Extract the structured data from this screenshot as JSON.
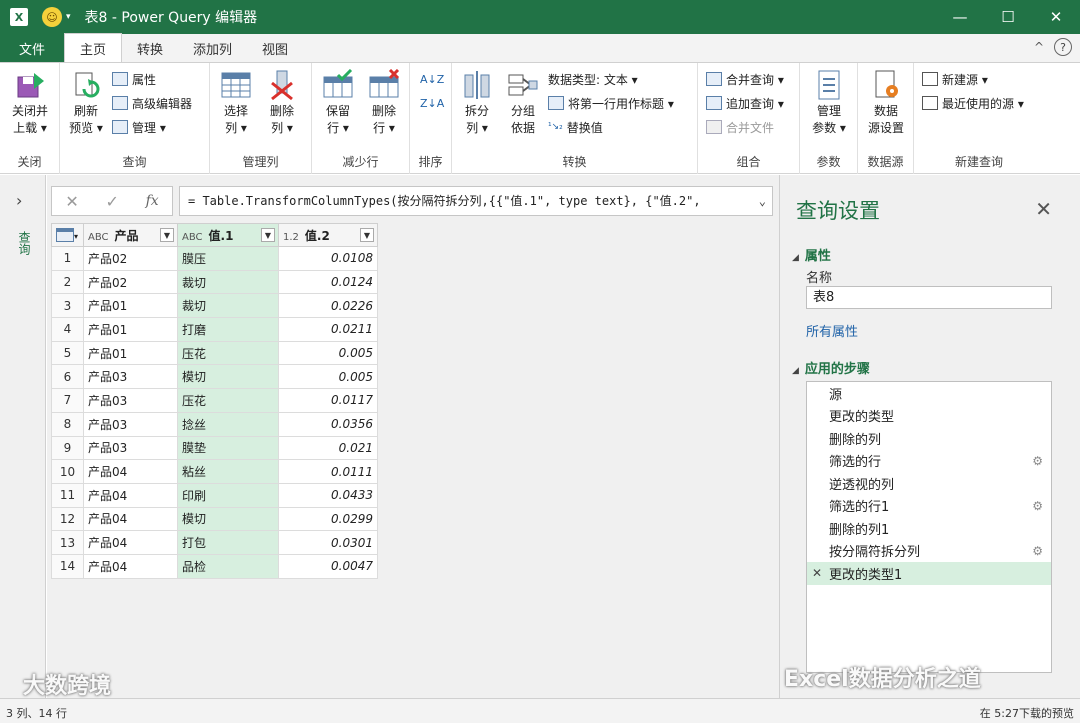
{
  "window": {
    "app_icon": "X↗",
    "title": "表8 - Power Query 编辑器",
    "minimize": "—",
    "maximize": "☐",
    "close": "✕"
  },
  "tabs": [
    {
      "label": "文件"
    },
    {
      "label": "主页"
    },
    {
      "label": "转换"
    },
    {
      "label": "添加列"
    },
    {
      "label": "视图"
    }
  ],
  "ribbon": {
    "close_load": {
      "label1": "关闭并",
      "label2": "上载 ▾"
    },
    "refresh": {
      "label1": "刷新",
      "label2": "预览 ▾"
    },
    "properties": "属性",
    "advanced_editor": "高级编辑器",
    "manage": "管理 ▾",
    "choose_cols": {
      "label1": "选择",
      "label2": "列 ▾"
    },
    "remove_cols": {
      "label1": "删除",
      "label2": "列 ▾"
    },
    "keep_rows": {
      "label1": "保留",
      "label2": "行 ▾"
    },
    "remove_rows": {
      "label1": "删除",
      "label2": "行 ▾"
    },
    "sort_asc": "A↓Z",
    "sort_desc": "Z↓A",
    "split_col": {
      "label1": "拆分",
      "label2": "列 ▾"
    },
    "group_by": {
      "label1": "分组",
      "label2": "依据"
    },
    "data_type": "数据类型: 文本 ▾",
    "first_row_header": "将第一行用作标题 ▾",
    "replace_values": "替换值",
    "merge_queries": "合并查询 ▾",
    "append_queries": "追加查询 ▾",
    "combine_files": "合并文件",
    "manage_params": {
      "label1": "管理",
      "label2": "参数 ▾"
    },
    "data_source_settings": {
      "label1": "数据",
      "label2": "源设置"
    },
    "new_source": "新建源 ▾",
    "recent_sources": "最近使用的源 ▾",
    "groups": {
      "close": "关闭",
      "query": "查询",
      "manage_cols": "管理列",
      "reduce_rows": "减少行",
      "sort": "排序",
      "transform": "转换",
      "combine": "组合",
      "params": "参数",
      "data_source": "数据源",
      "new_query": "新建查询"
    }
  },
  "left_panel": {
    "expand": "›",
    "label": "查询"
  },
  "formula_bar": {
    "cancel": "✕",
    "confirm": "✓",
    "fx": "fx",
    "text": "= Table.TransformColumnTypes(按分隔符拆分列,{{\"值.1\", type text}, {\"值.2\",",
    "expand": "⌄"
  },
  "table": {
    "columns": [
      {
        "type": "ABC",
        "name": "产品"
      },
      {
        "type": "ABC",
        "name": "值.1"
      },
      {
        "type": "1.2",
        "name": "值.2"
      }
    ],
    "rows": [
      {
        "n": "1",
        "product": "产品02",
        "v1": "膜压",
        "v2": "0.0108"
      },
      {
        "n": "2",
        "product": "产品02",
        "v1": "裁切",
        "v2": "0.0124"
      },
      {
        "n": "3",
        "product": "产品01",
        "v1": "裁切",
        "v2": "0.0226"
      },
      {
        "n": "4",
        "product": "产品01",
        "v1": "打磨",
        "v2": "0.0211"
      },
      {
        "n": "5",
        "product": "产品01",
        "v1": "压花",
        "v2": "0.005"
      },
      {
        "n": "6",
        "product": "产品03",
        "v1": "模切",
        "v2": "0.005"
      },
      {
        "n": "7",
        "product": "产品03",
        "v1": "压花",
        "v2": "0.0117"
      },
      {
        "n": "8",
        "product": "产品03",
        "v1": "捻丝",
        "v2": "0.0356"
      },
      {
        "n": "9",
        "product": "产品03",
        "v1": "膜垫",
        "v2": "0.021"
      },
      {
        "n": "10",
        "product": "产品04",
        "v1": "粘丝",
        "v2": "0.0111"
      },
      {
        "n": "11",
        "product": "产品04",
        "v1": "印刷",
        "v2": "0.0433"
      },
      {
        "n": "12",
        "product": "产品04",
        "v1": "模切",
        "v2": "0.0299"
      },
      {
        "n": "13",
        "product": "产品04",
        "v1": "打包",
        "v2": "0.0301"
      },
      {
        "n": "14",
        "product": "产品04",
        "v1": "品检",
        "v2": "0.0047"
      }
    ]
  },
  "query_settings": {
    "title": "查询设置",
    "close": "✕",
    "properties_header": "属性",
    "name_label": "名称",
    "name_value": "表8",
    "all_properties": "所有属性",
    "steps_header": "应用的步骤",
    "steps": [
      {
        "label": "源",
        "gear": false
      },
      {
        "label": "更改的类型",
        "gear": false
      },
      {
        "label": "删除的列",
        "gear": false
      },
      {
        "label": "筛选的行",
        "gear": true
      },
      {
        "label": "逆透视的列",
        "gear": false
      },
      {
        "label": "筛选的行1",
        "gear": true
      },
      {
        "label": "删除的列1",
        "gear": false
      },
      {
        "label": "按分隔符拆分列",
        "gear": true
      },
      {
        "label": "更改的类型1",
        "gear": false,
        "selected": true
      }
    ]
  },
  "status": {
    "left": "3 列、14 行",
    "right": "在 5:27下载的预览"
  },
  "watermarks": {
    "bottom_left": "大数跨境",
    "bottom_right": "Excel数据分析之道"
  },
  "colors": {
    "excel_green": "#217346",
    "selected_col": "#d7efdf",
    "link_blue": "#2163a8"
  }
}
